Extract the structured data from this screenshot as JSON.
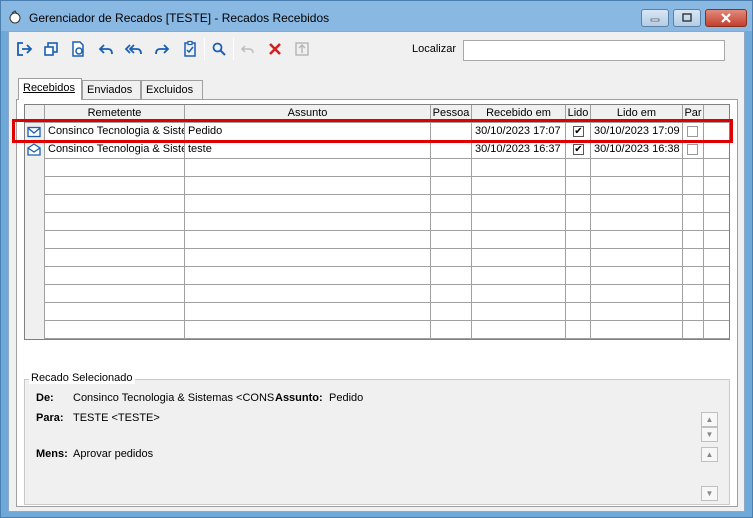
{
  "window": {
    "title": "Gerenciador de Recados  [TESTE] - Recados Recebidos"
  },
  "colors": {
    "title_bg": "#89b9e3",
    "close_button": "#c2402e",
    "highlight": "#e10000",
    "grid_line": "#a0a0a0",
    "icon_blue": "#1a5fb4",
    "delete_red": "#d42020"
  },
  "toolbar": {
    "buttons": [
      {
        "icon": "exit-icon"
      },
      {
        "icon": "new-window-icon"
      },
      {
        "icon": "view-document-icon"
      },
      {
        "icon": "reply-icon"
      },
      {
        "icon": "reply-all-icon"
      },
      {
        "icon": "forward-icon"
      },
      {
        "icon": "clipboard-check-icon"
      },
      {
        "icon": "search-icon"
      },
      {
        "icon": "undo-icon"
      },
      {
        "icon": "delete-icon"
      },
      {
        "icon": "disabled-export-icon"
      }
    ],
    "search_label": "Localizar",
    "search_value": ""
  },
  "tabs": [
    {
      "label": "Recebidos",
      "active": true
    },
    {
      "label": "Enviados",
      "active": false
    },
    {
      "label": "Excluidos",
      "active": false
    }
  ],
  "grid": {
    "columns": [
      "",
      "Remetente",
      "Assunto",
      "Pessoa",
      "Recebido em",
      "Lido",
      "Lido em",
      "Par"
    ],
    "rows": [
      {
        "icon": "envelope-closed-icon",
        "remetente": "Consinco Tecnologia & Siste",
        "assunto": "Pedido",
        "pessoa": "",
        "recebido_em": "30/10/2023 17:07",
        "lido": true,
        "lido_em": "30/10/2023 17:09",
        "par": false
      },
      {
        "icon": "envelope-open-icon",
        "remetente": "Consinco Tecnologia & Siste",
        "assunto": "teste",
        "pessoa": "",
        "recebido_em": "30/10/2023 16:37",
        "lido": true,
        "lido_em": "30/10/2023 16:38",
        "par": false
      }
    ]
  },
  "selected_message": {
    "group_title": "Recado Selecionado",
    "de_label": "De:",
    "de_value": "Consinco Tecnologia & Sistemas <CONS",
    "assunto_label": "Assunto:",
    "assunto_value": "Pedido",
    "para_label": "Para:",
    "para_value": "TESTE <TESTE>",
    "mens_label": "Mens:",
    "mens_value": "Aprovar pedidos"
  }
}
